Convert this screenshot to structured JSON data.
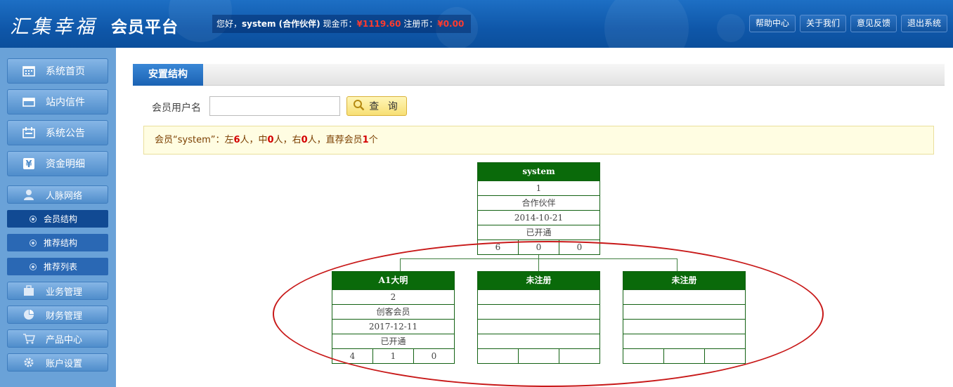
{
  "header": {
    "logo": "汇集幸福",
    "platform": "会员平台",
    "greeting": "您好，",
    "username": "system (合作伙伴)",
    "cash_label": "现金币：",
    "cash_value": "¥1119.60",
    "reg_label": "注册币：",
    "reg_value": "¥0.00",
    "nav": [
      "帮助中心",
      "关于我们",
      "意见反馈",
      "退出系统"
    ]
  },
  "sidebar": {
    "items": [
      {
        "label": "系统首页",
        "icon": "calendar-icon"
      },
      {
        "label": "站内信件",
        "icon": "mail-icon"
      },
      {
        "label": "系统公告",
        "icon": "notice-icon"
      },
      {
        "label": "资金明细",
        "icon": "yen-icon"
      }
    ],
    "network": {
      "label": "人脉网络",
      "icon": "user-icon"
    },
    "subitems": [
      "会员结构",
      "推荐结构",
      "推荐列表"
    ],
    "bottom": [
      {
        "label": "业务管理",
        "icon": "briefcase-icon"
      },
      {
        "label": "财务管理",
        "icon": "piechart-icon"
      },
      {
        "label": "产品中心",
        "icon": "cart-icon"
      },
      {
        "label": "账户设置",
        "icon": "gear-icon"
      }
    ]
  },
  "main": {
    "tab": "安置结构",
    "search_label": "会员用户名",
    "search_value": "",
    "search_button": "查 询",
    "notice": {
      "p1": "会员“system”：左",
      "left": "6",
      "p2": "人，中",
      "mid": "0",
      "p3": "人，右",
      "right": "0",
      "p4": "人，直荐会员",
      "direct": "1",
      "p5": "个"
    }
  },
  "tree": {
    "root": {
      "name": "system",
      "id": "1",
      "level": "合作伙伴",
      "date": "2014-10-21",
      "status": "已开通",
      "counts": [
        "6",
        "0",
        "0"
      ]
    },
    "children": [
      {
        "name": "A1大明",
        "id": "2",
        "level": "创客会员",
        "date": "2017-12-11",
        "status": "已开通",
        "counts": [
          "4",
          "1",
          "0"
        ]
      },
      {
        "name": "未注册",
        "id": "",
        "level": "",
        "date": "",
        "status": "",
        "counts": [
          "",
          "",
          ""
        ]
      },
      {
        "name": "未注册",
        "id": "",
        "level": "",
        "date": "",
        "status": "",
        "counts": [
          "",
          "",
          ""
        ]
      }
    ]
  },
  "colors": {
    "header": "#0f57a9",
    "sidebar": "#6aa2d8",
    "node_header": "#0a6a0a",
    "highlight": "#c81919",
    "money": "#ff3b2f"
  }
}
